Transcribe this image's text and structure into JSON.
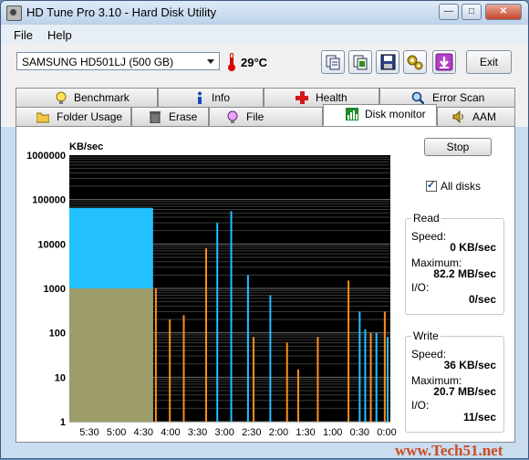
{
  "window": {
    "title": "HD Tune Pro 3.10 - Hard Disk Utility"
  },
  "menu": [
    {
      "label": "File"
    },
    {
      "label": "Help"
    }
  ],
  "toolbar": {
    "drive": "SAMSUNG HD501LJ (500 GB)",
    "temperature": "29°C",
    "exit_label": "Exit"
  },
  "tabs_top": [
    {
      "label": "Benchmark",
      "icon": "lightbulb-icon"
    },
    {
      "label": "Info",
      "icon": "info-icon"
    },
    {
      "label": "Health",
      "icon": "health-cross-icon"
    },
    {
      "label": "Error Scan",
      "icon": "magnifier-icon"
    }
  ],
  "tabs_bottom": [
    {
      "label": "Folder Usage",
      "icon": "folder-icon"
    },
    {
      "label": "Erase",
      "icon": "trash-icon"
    },
    {
      "label": "File Benchmark",
      "icon": "file-benchmark-icon"
    },
    {
      "label": "Disk monitor",
      "icon": "disk-monitor-icon",
      "active": true
    },
    {
      "label": "AAM",
      "icon": "speaker-icon"
    }
  ],
  "monitor": {
    "stop_label": "Stop",
    "all_disks_label": "All disks",
    "all_disks_checked": true,
    "read": {
      "title": "Read",
      "speed_label": "Speed:",
      "speed_value": "0 KB/sec",
      "max_label": "Maximum:",
      "max_value": "82.2 MB/sec",
      "io_label": "I/O:",
      "io_value": "0/sec"
    },
    "write": {
      "title": "Write",
      "speed_label": "Speed:",
      "speed_value": "36 KB/sec",
      "max_label": "Maximum:",
      "max_value": "20.7 MB/sec",
      "io_label": "I/O:",
      "io_value": "11/sec"
    }
  },
  "chart_data": {
    "type": "area",
    "ylabel": "KB/sec",
    "y_scale": "log",
    "ylim": [
      1,
      1000000
    ],
    "y_ticks": [
      "1000000",
      "100000",
      "10000",
      "1000",
      "100",
      "10",
      "1"
    ],
    "x_ticks": [
      "5:30",
      "5:00",
      "4:30",
      "4:00",
      "3:30",
      "3:00",
      "2:30",
      "2:00",
      "1:30",
      "1:00",
      "0:30",
      "0:00"
    ],
    "x_range_minutes": [
      5.75,
      0
    ],
    "grid": true,
    "background": "#000000",
    "series": [
      {
        "color": "#22c0ff",
        "segments": [
          {
            "x0": 5.75,
            "x1": 4.25,
            "y": 65000
          },
          {
            "x": 3.1,
            "y": 30000
          },
          {
            "x": 2.85,
            "y": 55000
          },
          {
            "x": 2.55,
            "y": 2000
          },
          {
            "x": 2.15,
            "y": 700
          },
          {
            "x": 0.55,
            "y": 300
          },
          {
            "x": 0.45,
            "y": 120
          },
          {
            "x": 0.25,
            "y": 100
          },
          {
            "x": 0.05,
            "y": 80
          }
        ]
      },
      {
        "color": "#ff8c1a",
        "segments": [
          {
            "x": 4.2,
            "y": 1000
          },
          {
            "x": 3.95,
            "y": 200
          },
          {
            "x": 3.7,
            "y": 250
          },
          {
            "x": 3.3,
            "y": 8000
          },
          {
            "x": 2.45,
            "y": 80
          },
          {
            "x": 1.85,
            "y": 60
          },
          {
            "x": 1.65,
            "y": 15
          },
          {
            "x": 1.3,
            "y": 80
          },
          {
            "x": 0.75,
            "y": 1500
          },
          {
            "x": 0.35,
            "y": 100
          },
          {
            "x": 0.1,
            "y": 300
          }
        ]
      },
      {
        "color": "#9c9c6a",
        "segments": [
          {
            "x0": 5.75,
            "x1": 4.25,
            "y": 1000
          }
        ]
      }
    ]
  },
  "watermark": "www.Tech51.net"
}
